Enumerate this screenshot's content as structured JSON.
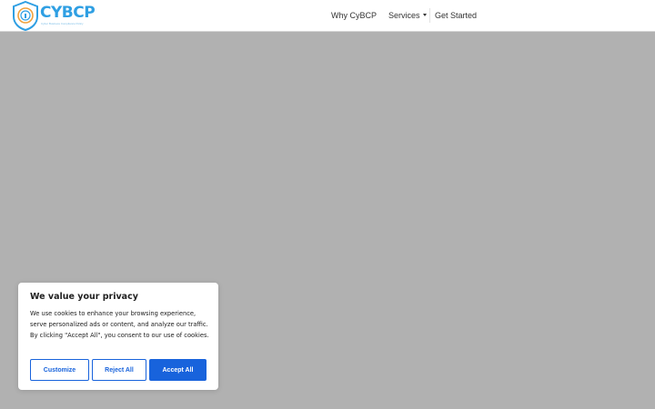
{
  "brand": {
    "name": "CYBCP",
    "tagline": "Cyber Business Compliance Policy"
  },
  "nav": {
    "why": "Why CyBCP",
    "services": "Services",
    "get_started": "Get Started"
  },
  "cookie_banner": {
    "title": "We value your privacy",
    "body": "We use cookies to enhance your browsing experience, serve personalized ads or content, and analyze our traffic. By clicking \"Accept All\", you consent to our use of cookies.",
    "customize_label": "Customize",
    "reject_label": "Reject All",
    "accept_label": "Accept All"
  },
  "colors": {
    "accent": "#1863dc",
    "brand": "#2f9fe3",
    "overlay": "#b1b1b1"
  },
  "icons": {
    "logo": "shield-lock-icon",
    "services_dropdown": "caret-down-icon"
  }
}
